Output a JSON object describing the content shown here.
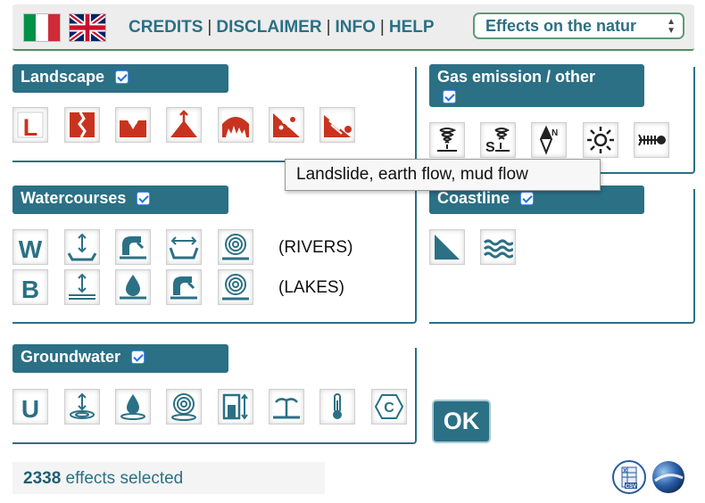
{
  "header": {
    "flags": [
      {
        "name": "Italian language",
        "colors": [
          "#009246",
          "#ffffff",
          "#ce2b37"
        ]
      },
      {
        "name": "English language",
        "colors": [
          "#012169",
          "#ffffff",
          "#c8102e"
        ]
      }
    ],
    "links": [
      "CREDITS",
      "DISCLAIMER",
      "INFO",
      "HELP"
    ],
    "select": {
      "value": "Effects on the natur"
    }
  },
  "sections": {
    "landscape": {
      "title": "Landscape",
      "checked": true,
      "icons": [
        "letter-l-icon",
        "fault-scarp-icon",
        "subsidence-icon",
        "uplift-icon",
        "cave-collapse-icon",
        "rockfall-icon",
        "landslide-icon"
      ]
    },
    "gas": {
      "title": "Gas emission / other",
      "checked": true,
      "icons": [
        "gas-emission-icon",
        "sulfur-gas-icon",
        "compass-anomaly-icon",
        "light-phenomena-icon",
        "dead-fish-icon"
      ]
    },
    "watercourses": {
      "title": "Watercourses",
      "checked": true,
      "rows": [
        {
          "letter": "W",
          "label": "(RIVERS)"
        },
        {
          "letter": "B",
          "label": "(LAKES)"
        }
      ]
    },
    "coastline": {
      "title": "Coastline",
      "checked": true
    },
    "groundwater": {
      "title": "Groundwater",
      "checked": true,
      "letter": "U"
    }
  },
  "tooltip": "Landslide, earth flow, mud flow",
  "ok_label": "OK",
  "status": {
    "count": "2338",
    "suffix": " effects selected"
  },
  "colors": {
    "accent": "#2b7085",
    "icon_red": "#c8331f",
    "icon_teal": "#2b7085"
  }
}
